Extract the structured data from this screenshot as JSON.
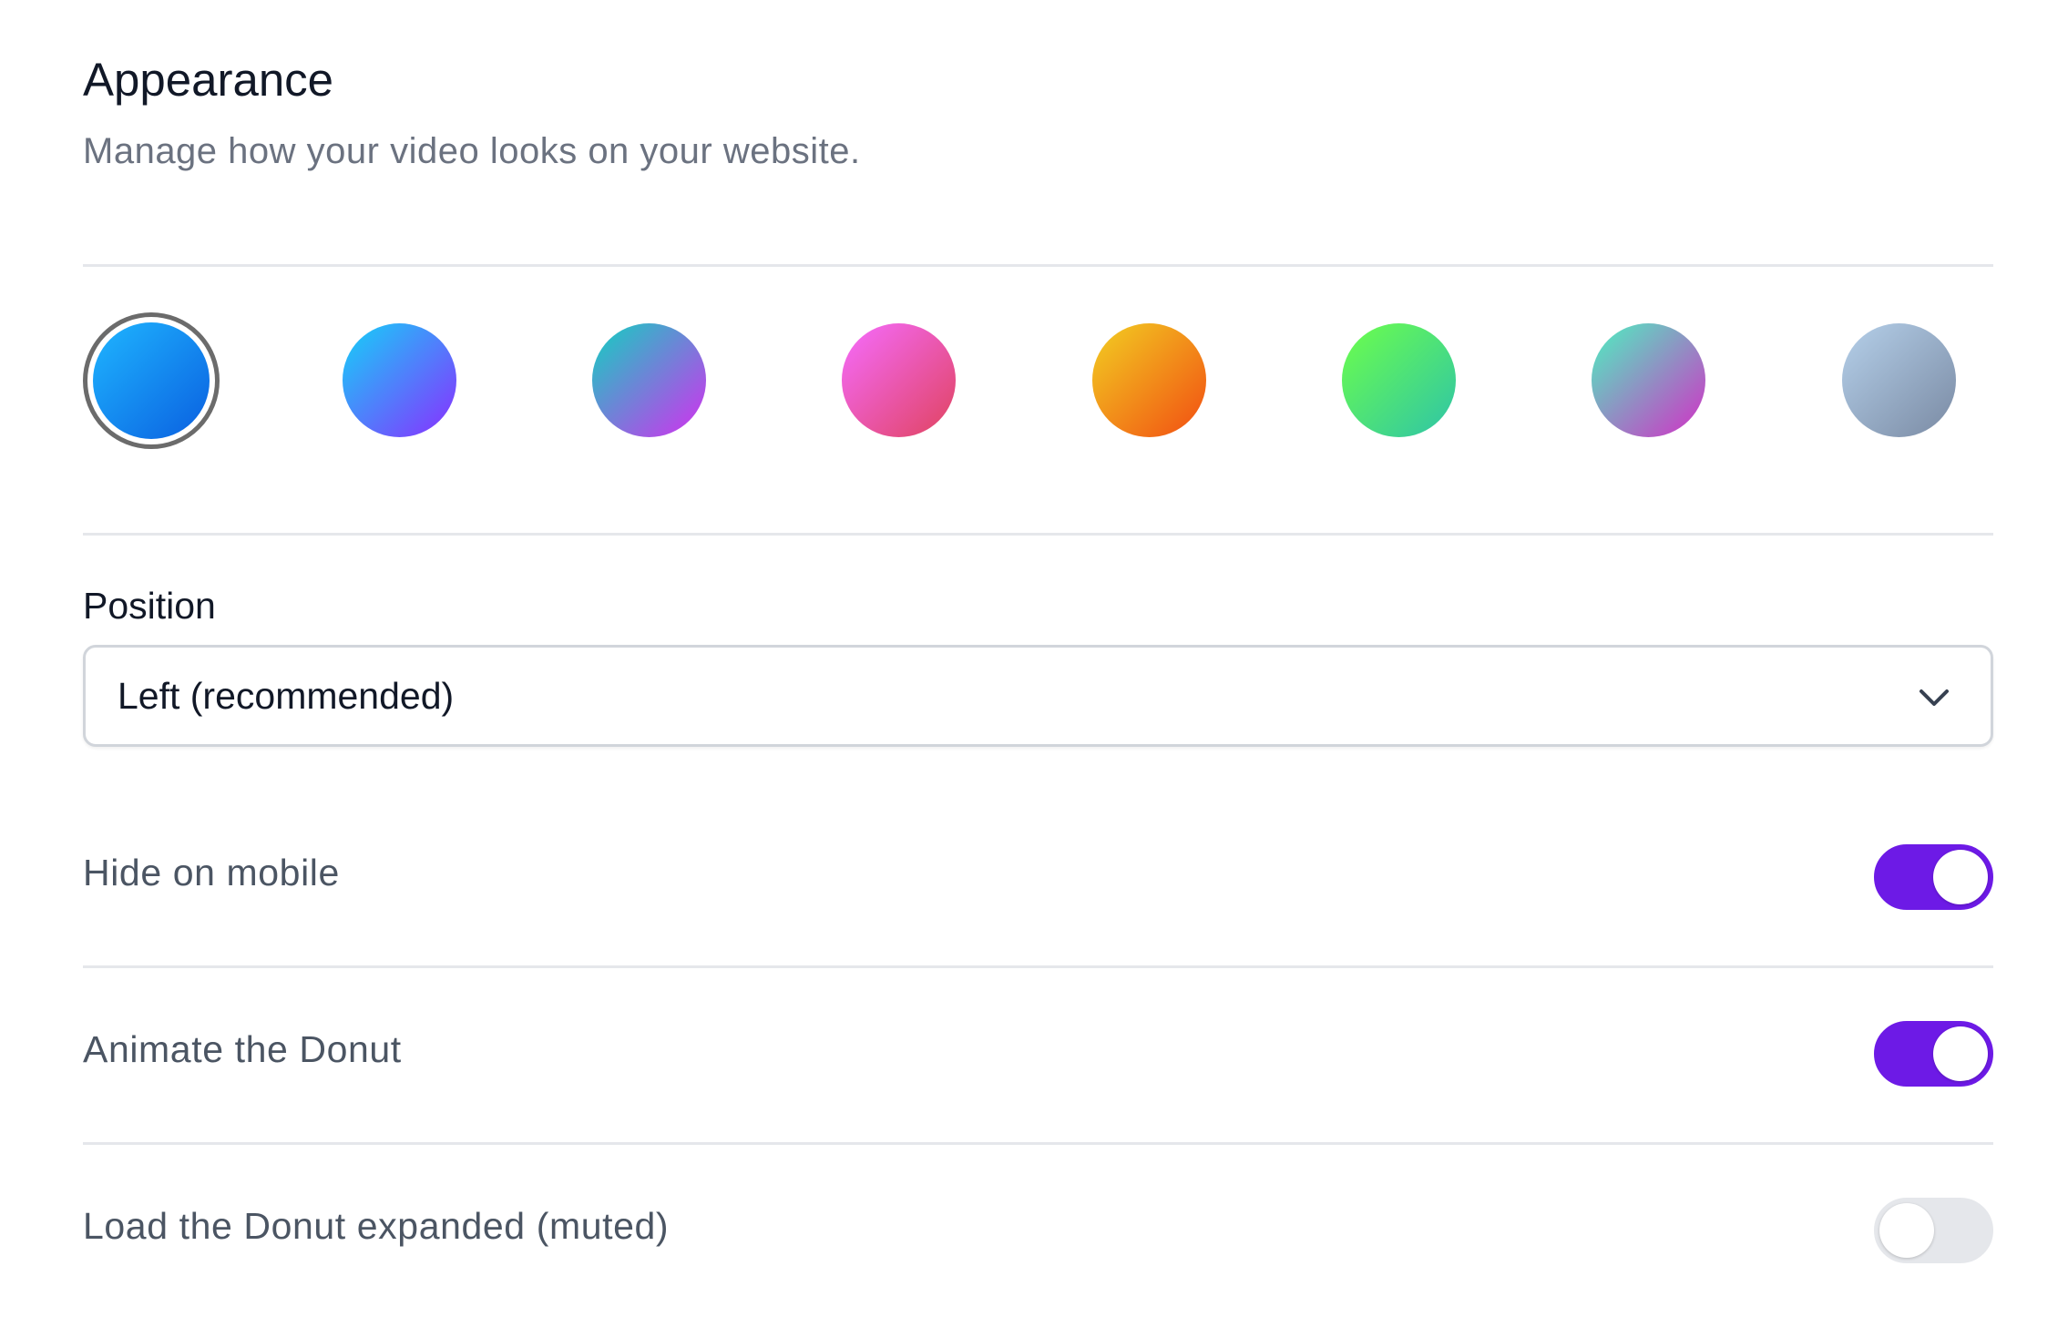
{
  "header": {
    "title": "Appearance",
    "subtitle": "Manage how your video looks on your website."
  },
  "colors": {
    "selected_index": 0,
    "swatches": [
      {
        "name": "blue",
        "from": "#1fb6ff",
        "to": "#0a5fe0"
      },
      {
        "name": "sky-violet",
        "from": "#14d2f8",
        "to": "#8a2eff"
      },
      {
        "name": "teal-magenta",
        "from": "#10d2c0",
        "to": "#d52ef0"
      },
      {
        "name": "pink-rose",
        "from": "#f56cff",
        "to": "#e0435f"
      },
      {
        "name": "amber-orange",
        "from": "#f2cf22",
        "to": "#f24d12"
      },
      {
        "name": "lime-teal",
        "from": "#6dff4a",
        "to": "#2ec4a8"
      },
      {
        "name": "mint-magenta",
        "from": "#4cf2c0",
        "to": "#d32fc6"
      },
      {
        "name": "slate",
        "from": "#b5d0ea",
        "to": "#7a8aa3"
      }
    ]
  },
  "position": {
    "label": "Position",
    "value": "Left (recommended)",
    "chevron_icon": "chevron-down-icon"
  },
  "settings": [
    {
      "label": "Hide on mobile",
      "enabled": true
    },
    {
      "label": "Animate the Donut",
      "enabled": true
    },
    {
      "label": "Load the Donut expanded (muted)",
      "enabled": false
    }
  ],
  "theme": {
    "toggle_on": "#6d1ae6",
    "toggle_off": "#e5e7eb",
    "divider": "#e5e7eb"
  }
}
